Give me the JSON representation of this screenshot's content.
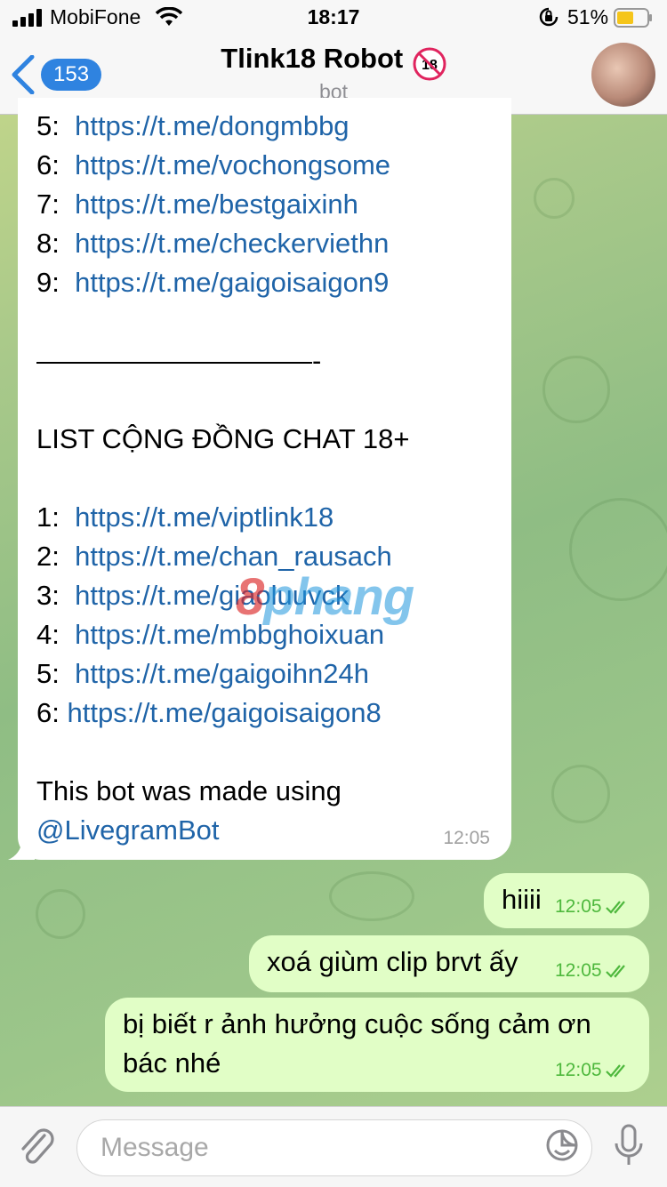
{
  "status_bar": {
    "carrier": "MobiFone",
    "time": "18:17",
    "battery_percent": "51%",
    "icons": [
      "signal-icon",
      "wifi-icon",
      "orientation-lock-icon",
      "battery-icon"
    ]
  },
  "header": {
    "back_count": "153",
    "title": "Tlink18 Robot",
    "title_badge": "18",
    "subtitle": "bot"
  },
  "incoming_message": {
    "list_a": [
      {
        "num": "5:",
        "url": "https://t.me/dongmbbg"
      },
      {
        "num": "6:",
        "url": "https://t.me/vochongsome"
      },
      {
        "num": "7:",
        "url": "https://t.me/bestgaixinh"
      },
      {
        "num": "8:",
        "url": "https://t.me/checkerviethn"
      },
      {
        "num": "9:",
        "url": "https://t.me/gaigoisaigon9"
      }
    ],
    "divider": "——————————-",
    "section_title": "LIST CỘNG ĐỒNG CHAT 18+",
    "list_b": [
      {
        "num": "1:",
        "url": "https://t.me/viptlink18"
      },
      {
        "num": "2:",
        "url": "https://t.me/chan_rausach"
      },
      {
        "num": "3:",
        "url": "https://t.me/giaoluuvck"
      },
      {
        "num": "4:",
        "url": "https://t.me/mbbghoixuan"
      },
      {
        "num": "5:",
        "url": "https://t.me/gaigoihn24h"
      },
      {
        "num": "6:",
        "url": "https://t.me/gaigoisaigon8"
      }
    ],
    "footer_text": "This bot was made using",
    "footer_mention": "@LivegramBot",
    "time": "12:05"
  },
  "outgoing_messages": [
    {
      "text_line1": "hiiii",
      "time": "12:05"
    },
    {
      "text_line1": "xoá giùm clip brvt ấy",
      "time": "12:05"
    },
    {
      "text_line1": "bị biết r ảnh hưởng cuộc sống cảm ơn",
      "text_line2": "bác nhé",
      "time": "12:05"
    }
  ],
  "watermark": {
    "part1": "8",
    "part2": "phang"
  },
  "input_bar": {
    "placeholder": "Message"
  },
  "colors": {
    "link": "#1f64a8",
    "outgoing_bubble": "#e1fec6",
    "badge": "#2f83e0",
    "read_ticks": "#4eb83d"
  }
}
